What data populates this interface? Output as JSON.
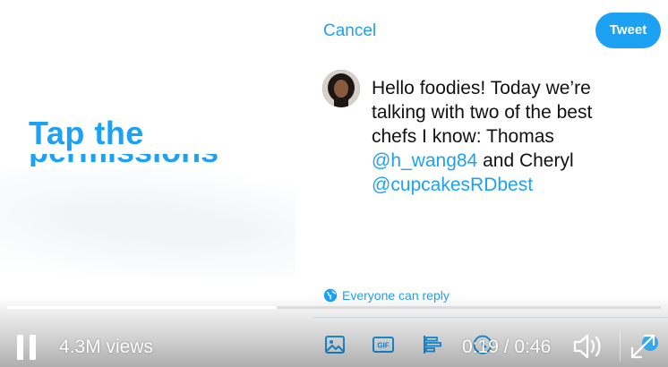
{
  "video": {
    "overlay_title": "Tap the",
    "overlay_subtitle": "permissions",
    "views": "4.3M views",
    "time_current": "0:19",
    "time_total": "0:46",
    "progress": 0.413
  },
  "compose": {
    "cancel_label": "Cancel",
    "tweet_label": "Tweet",
    "avatar_alt": "user avatar",
    "text_segments": [
      {
        "text": "Hello foodies! Today we’re talking with two of the best chefs I know: Thomas ",
        "type": "text"
      },
      {
        "text": "@h_wang84",
        "type": "mention"
      },
      {
        "text": " and Cheryl ",
        "type": "text"
      },
      {
        "text": "@cupcakesRDbest",
        "type": "mention"
      }
    ],
    "reply_setting": {
      "icon": "globe-icon",
      "label": "Everyone can reply"
    },
    "toolbar": [
      {
        "name": "image-icon"
      },
      {
        "name": "gif-icon",
        "label": "GIF"
      },
      {
        "name": "poll-icon"
      },
      {
        "name": "schedule-icon"
      }
    ]
  },
  "colors": {
    "accent": "#1da1f2",
    "text": "#111111",
    "divider": "#e1e8ed"
  }
}
